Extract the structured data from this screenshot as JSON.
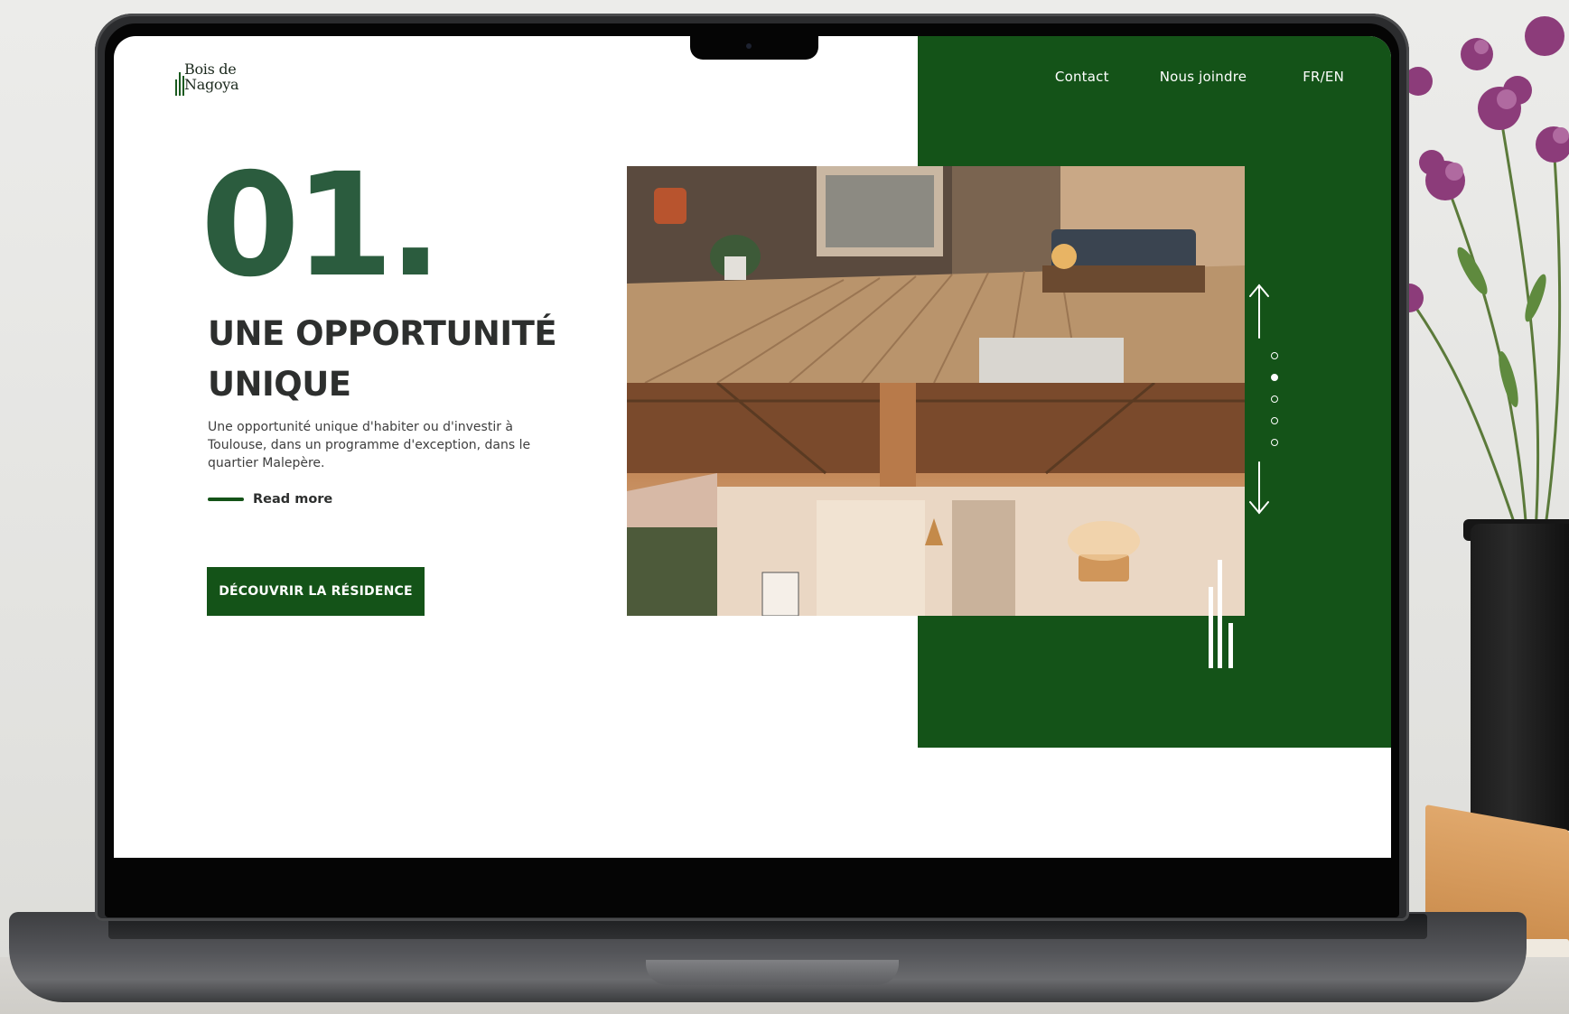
{
  "site": {
    "logo": {
      "line1": "Bois de",
      "line2": "Nagoya"
    },
    "nav": {
      "contact": "Contact",
      "join": "Nous joindre",
      "language": "FR/EN"
    }
  },
  "hero": {
    "number": "01.",
    "title_line1": "UNE OPPORTUNITÉ",
    "title_line2": "UNIQUE",
    "description": "Une opportunité unique d'habiter ou d'investir à Toulouse, dans un programme d'exception, dans le quartier Malepère.",
    "read_more": "Read more",
    "cta": "DÉCOUVRIR LA RÉSIDENCE"
  },
  "slider": {
    "total_slides": 5,
    "active_index": 1
  },
  "colors": {
    "brand_green": "#145318",
    "number_green": "#2b5c3e",
    "text_dark": "#2d2f2e",
    "white": "#ffffff"
  },
  "icons": {
    "up": "arrow-up-icon",
    "down": "arrow-down-icon",
    "logo": "tree-bars-icon"
  }
}
